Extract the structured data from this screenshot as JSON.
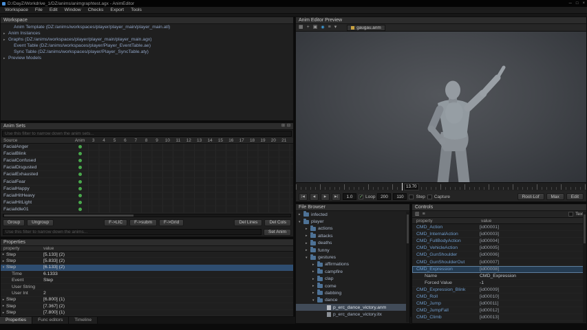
{
  "window": {
    "title": "D:/DayZ/Workdrive_1/DZ/anims/animgraphtest.agx - AnimEditor",
    "controls": {
      "minimize": "─",
      "maximize": "□",
      "close": "×"
    }
  },
  "menu_bar": {
    "items": [
      "Workspace",
      "File",
      "Edit",
      "Window",
      "Checks",
      "Export",
      "Tools"
    ]
  },
  "workspace_panel": {
    "title": "Workspace",
    "items": [
      {
        "label": "Anim Template (DZ:/anims/workspaces/player/player_main/player_main.atl)",
        "arrow": "",
        "cls": "ind1"
      },
      {
        "label": "Anim Instances",
        "arrow": "▸",
        "cls": "ind0"
      },
      {
        "label": "Graphs (DZ:/anims/workspaces/player/player_main/player_main.agx)",
        "arrow": "▸",
        "cls": "ind0"
      },
      {
        "label": "Event Table (DZ:/anims/workspaces/player/Player_EventTable.ae)",
        "arrow": "",
        "cls": "ind1"
      },
      {
        "label": "Sync Table (DZ:/anims/workspaces/player/Player_SyncTable.aty)",
        "arrow": "",
        "cls": "ind1"
      },
      {
        "label": "Preview Models",
        "arrow": "▸",
        "cls": "ind0"
      }
    ]
  },
  "anim_sets_panel": {
    "title": "Anim Sets",
    "header_icons": {
      "icon1": "⊞",
      "icon2": "⊟"
    },
    "filter_hint": "Use this filter to narrow down the anim sets...",
    "filter2_hint": "Use this filter to narrow down the anims...",
    "columns": {
      "source": "Source",
      "anim": "Anim",
      "numbers": [
        "3",
        "4",
        "5",
        "6",
        "7",
        "8",
        "9",
        "10",
        "11",
        "12",
        "13",
        "14",
        "15",
        "16",
        "17",
        "18",
        "19",
        "20",
        "21"
      ]
    },
    "rows": [
      {
        "source": "FacialAnger"
      },
      {
        "source": "FacialBlink"
      },
      {
        "source": "FacialConfused"
      },
      {
        "source": "FacialDisgusted"
      },
      {
        "source": "FacialExhausted"
      },
      {
        "source": "FacialFear"
      },
      {
        "source": "FacialHappy"
      },
      {
        "source": "FacialHitHeavy"
      },
      {
        "source": "FacialHitLight"
      },
      {
        "source": "FacialIdle01"
      }
    ],
    "buttons": {
      "group": "Group",
      "ungroup": "Ungroup",
      "f_lic": "F->LIC",
      "f_subm": "F->subm",
      "f_grid": "F->Grid",
      "del_lines": "Del Lines",
      "del_cols": "Del Cols",
      "set_anim": "Set Anim"
    }
  },
  "properties_panel": {
    "title": "Properties",
    "columns": {
      "property": "property",
      "value": "value"
    },
    "rows": [
      {
        "property": "Step",
        "value": "[5.133] (2)",
        "arrow": "▸",
        "cls": ""
      },
      {
        "property": "Step",
        "value": "[5.833] (2)",
        "arrow": "▸",
        "cls": ""
      },
      {
        "property": "Step",
        "value": "[6.133] (2)",
        "arrow": "▾",
        "cls": "selected"
      },
      {
        "property": "Time",
        "value": "6.1333",
        "arrow": "",
        "cls": "child"
      },
      {
        "property": "Event",
        "value": "Step",
        "arrow": "",
        "cls": "child"
      },
      {
        "property": "User String",
        "value": "",
        "arrow": "",
        "cls": "child"
      },
      {
        "property": "User Int",
        "value": "2",
        "arrow": "",
        "cls": "child"
      },
      {
        "property": "Step",
        "value": "[6.800] (1)",
        "arrow": "▸",
        "cls": ""
      },
      {
        "property": "Step",
        "value": "[7.367] (2)",
        "arrow": "▸",
        "cls": ""
      },
      {
        "property": "Step",
        "value": "[7.800] (1)",
        "arrow": "▸",
        "cls": ""
      }
    ],
    "tabs": [
      {
        "label": "Properties",
        "cls": "active"
      },
      {
        "label": "Func editors",
        "cls": ""
      },
      {
        "label": "Timeline",
        "cls": ""
      }
    ]
  },
  "preview_panel": {
    "title": "Anim Editor Preview",
    "toolbar": {
      "grid": "▦",
      "axes": "+",
      "camera": "▣",
      "record": "◉",
      "list": "≡",
      "dropdown": "▾"
    },
    "tab": {
      "label": "gaugau.anm"
    },
    "timeline": {
      "marker_label": "13.70"
    },
    "transport": {
      "first": "|◀",
      "prev": "◀",
      "play": "▶",
      "next": "▶|",
      "speed": "1.0",
      "loop": "Loop",
      "zoom": "200",
      "frames": "110",
      "step": "Step",
      "capture": "Capture",
      "root": "Root-Lof",
      "max": "Max",
      "edit": "Edit"
    }
  },
  "file_browser": {
    "title": "File Browser",
    "items": [
      {
        "label": "infected",
        "arrow": "▸",
        "cls": "ind0 folder"
      },
      {
        "label": "player",
        "arrow": "▾",
        "cls": "ind0 folder"
      },
      {
        "label": "actions",
        "arrow": "▸",
        "cls": "ind1 folder"
      },
      {
        "label": "attacks",
        "arrow": "▸",
        "cls": "ind1 folder"
      },
      {
        "label": "deaths",
        "arrow": "▸",
        "cls": "ind1 folder"
      },
      {
        "label": "funny",
        "arrow": "▸",
        "cls": "ind1 folder"
      },
      {
        "label": "gestures",
        "arrow": "▾",
        "cls": "ind1 folder"
      },
      {
        "label": "affirmations",
        "arrow": "▸",
        "cls": "ind2 folder"
      },
      {
        "label": "campfire",
        "arrow": "▸",
        "cls": "ind2 folder"
      },
      {
        "label": "clap",
        "arrow": "▸",
        "cls": "ind2 folder"
      },
      {
        "label": "come",
        "arrow": "▸",
        "cls": "ind2 folder"
      },
      {
        "label": "dabbing",
        "arrow": "▸",
        "cls": "ind2 folder"
      },
      {
        "label": "dance",
        "arrow": "▾",
        "cls": "ind2 folder"
      },
      {
        "label": "p_erc_dance_victory.anm",
        "arrow": "",
        "cls": "ind3 file selected"
      },
      {
        "label": "p_erc_dance_victory.itx",
        "arrow": "",
        "cls": "ind3 file itx"
      }
    ]
  },
  "controls_panel": {
    "title": "Controls",
    "toolbar": {
      "icon1": "▥",
      "icon2": "≡",
      "text_toggle": "Text"
    },
    "columns": {
      "property": "property",
      "value": "value"
    },
    "rows": [
      {
        "property": "CMD_Action",
        "value": "[id00001]",
        "cls": "cmd"
      },
      {
        "property": "CMD_InternalAction",
        "value": "[id00003]",
        "cls": "cmd"
      },
      {
        "property": "CMD_FullBodyAction",
        "value": "[id00004]",
        "cls": "cmd"
      },
      {
        "property": "CMD_VehicleAction",
        "value": "[id00005]",
        "cls": "cmd"
      },
      {
        "property": "CMD_GunShoulder",
        "value": "[id00006]",
        "cls": "cmd"
      },
      {
        "property": "CMD_GunShoulderOut",
        "value": "[id00007]",
        "cls": "cmd"
      },
      {
        "property": "CMD_Expression",
        "value": "[id00008]",
        "cls": "cmd selected"
      },
      {
        "property": "Name",
        "value": "CMD_Expression",
        "cls": "child"
      },
      {
        "property": "Forced Value",
        "value": "-1",
        "cls": "child"
      },
      {
        "property": "CMD_Expression_Blink",
        "value": "[id00009]",
        "cls": "cmd"
      },
      {
        "property": "CMD_Roll",
        "value": "[id00010]",
        "cls": "cmd"
      },
      {
        "property": "CMD_Jump",
        "value": "[id00011]",
        "cls": "cmd"
      },
      {
        "property": "CMD_JumpFall",
        "value": "[id00012]",
        "cls": "cmd"
      },
      {
        "property": "CMD_Climb",
        "value": "[id00013]",
        "cls": "cmd"
      }
    ]
  }
}
